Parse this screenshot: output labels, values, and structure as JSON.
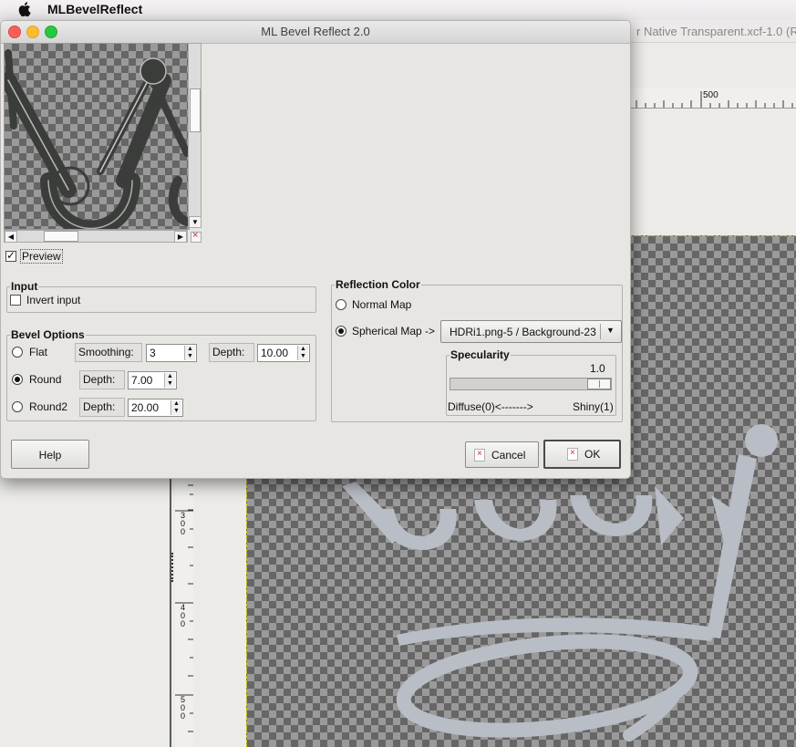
{
  "menubar": {
    "apple_icon": "apple-logo-icon",
    "app_name": "MLBevelReflect"
  },
  "background_window": {
    "title": "r Native Transparent.xcf-1.0 (R",
    "hruler_label": "500",
    "vruler_labels": [
      "3\n0\n0",
      "4\n0\n0",
      "5\n0\n0"
    ],
    "crown_color": "#b9bdc6"
  },
  "dialog": {
    "title": "ML Bevel Reflect 2.0",
    "preview_checkbox": {
      "label": "Preview",
      "checked": true
    },
    "input_frame": {
      "title": "Input",
      "invert_input": {
        "label": "Invert input",
        "checked": false
      }
    },
    "bevel_options": {
      "title": "Bevel Options",
      "flat": {
        "label": "Flat",
        "selected": false,
        "smoothing_label": "Smoothing:",
        "smoothing_value": "3",
        "depth_label": "Depth:",
        "depth_value": "10.00"
      },
      "round": {
        "label": "Round",
        "selected": true,
        "depth_label": "Depth:",
        "depth_value": "7.00"
      },
      "round2": {
        "label": "Round2",
        "selected": false,
        "depth_label": "Depth:",
        "depth_value": "20.00"
      }
    },
    "reflection_color": {
      "title": "Reflection Color",
      "normal_map": {
        "label": "Normal Map",
        "selected": false
      },
      "spherical_map": {
        "label": "Spherical Map ->",
        "selected": true,
        "dropdown_value": "HDRi1.png-5 / Background-23"
      },
      "specularity": {
        "title": "Specularity",
        "value": "1.0",
        "level": 1.0,
        "left_label": "Diffuse(0)<------->",
        "right_label": "Shiny(1)"
      }
    },
    "buttons": {
      "help": "Help",
      "cancel": "Cancel",
      "ok": "OK"
    }
  }
}
